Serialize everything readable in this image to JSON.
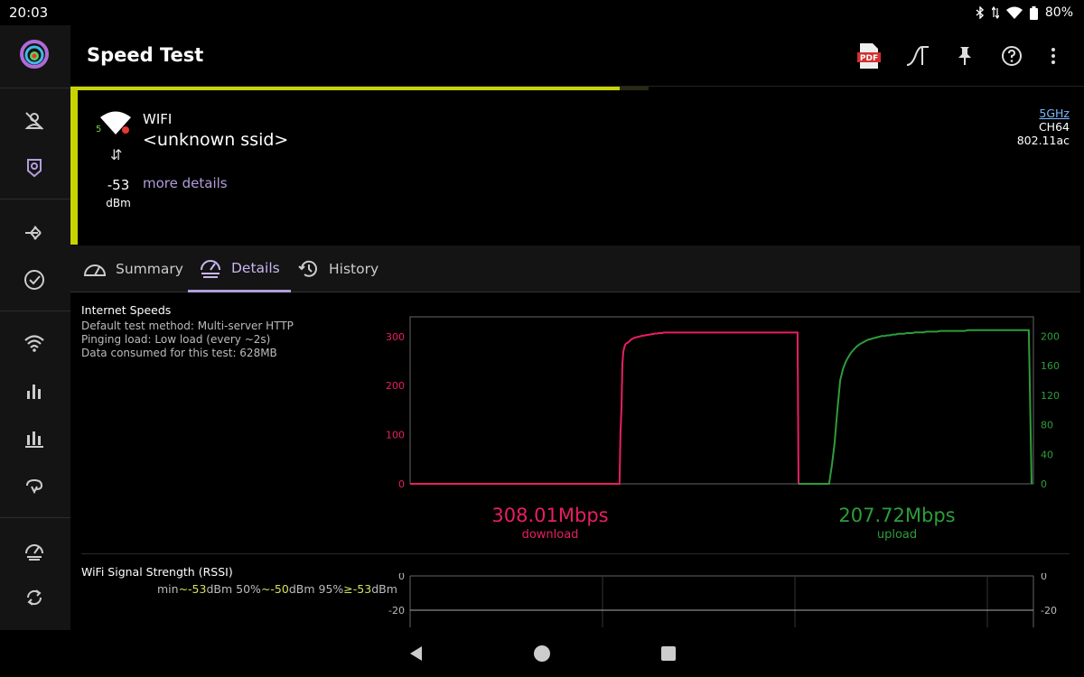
{
  "status": {
    "time": "20:03",
    "battery": "80%"
  },
  "rail": {
    "items": [
      {
        "name": "rail-no-person-icon"
      },
      {
        "name": "rail-badge-icon"
      },
      {
        "name": "rail-route-icon"
      },
      {
        "name": "rail-check-icon"
      },
      {
        "name": "rail-wifi-icon"
      },
      {
        "name": "rail-bar-chart-icon"
      },
      {
        "name": "rail-stacked-chart-icon"
      },
      {
        "name": "rail-loop-icon"
      },
      {
        "name": "rail-speedtest-icon"
      },
      {
        "name": "rail-sync-icon"
      }
    ]
  },
  "appbar": {
    "title": "Speed Test",
    "pdf_label": "PDF"
  },
  "network": {
    "band_small": "5",
    "type": "WIFI",
    "ssid": "<unknown ssid>",
    "rssi": "-53",
    "rssi_unit": "dBm",
    "more_details": "more details",
    "band": "5GHz",
    "channel": "CH64",
    "standard": "802.11ac"
  },
  "tabs": [
    {
      "label": "Summary",
      "active": false
    },
    {
      "label": "Details",
      "active": true
    },
    {
      "label": "History",
      "active": false
    }
  ],
  "internet": {
    "title": "Internet Speeds",
    "lines": [
      "Default test method: Multi-server HTTP",
      "Pinging load: Low load (every ~2s)",
      "Data consumed for this test: 628MB"
    ],
    "download_value": "308.01Mbps",
    "download_label": "download",
    "upload_value": "207.72Mbps",
    "upload_label": "upload"
  },
  "rssi_section": {
    "title": "WiFi Signal Strength (RSSI)",
    "min_label": "min",
    "min_value": "~-53",
    "p50_label": "50%",
    "p50_value": "~-50",
    "p95_label": "95%",
    "p95_value": "≥-53",
    "unit": "dBm"
  },
  "colors": {
    "download": "#e91e63",
    "upload": "#2e9d3a",
    "accent": "#c8d400",
    "tab_active": "#b39ddb"
  },
  "chart_data": [
    {
      "type": "line",
      "title": "",
      "y_left": {
        "ticks": [
          0,
          100,
          200,
          300
        ],
        "range": [
          0,
          340
        ],
        "color": "#e91e63"
      },
      "y_right": {
        "ticks": [
          0,
          40,
          80,
          120,
          160,
          200
        ],
        "range": [
          0,
          226
        ],
        "color": "#2e9d3a"
      },
      "series": [
        {
          "name": "download",
          "axis": "left",
          "color": "#e91e63",
          "values": [
            0,
            0,
            0,
            0,
            0,
            0,
            0,
            0,
            0,
            0,
            0,
            0,
            0,
            0,
            0,
            0,
            0,
            0,
            0,
            0,
            0,
            0,
            0,
            0,
            0,
            0,
            0,
            0,
            0,
            0,
            0,
            0,
            0,
            0,
            0,
            0,
            0,
            0,
            0,
            0,
            0,
            0,
            0,
            0,
            0,
            0,
            0,
            0,
            0,
            0,
            0,
            0,
            0,
            0,
            0,
            0,
            0,
            0,
            0,
            0,
            0,
            0,
            0,
            0,
            0,
            0,
            0,
            0,
            0,
            0,
            0,
            0,
            0,
            0,
            0,
            0,
            0,
            0,
            0,
            0,
            0,
            0,
            0,
            0,
            0,
            0,
            0,
            0,
            0,
            0,
            0,
            0,
            0,
            0,
            0,
            0,
            0,
            0,
            0,
            0,
            0,
            0,
            0,
            0,
            0,
            0,
            0,
            0,
            0,
            0,
            0,
            0,
            0,
            0,
            0,
            0,
            0,
            0,
            0,
            0,
            0,
            0,
            0,
            0,
            0,
            0,
            0,
            0,
            0,
            0,
            0,
            0,
            0,
            0,
            0,
            0,
            0,
            0,
            0,
            0,
            0,
            0,
            0,
            0,
            0,
            0,
            0,
            0,
            0,
            0,
            0,
            0,
            0,
            0,
            0,
            0,
            0,
            0,
            0,
            0,
            0,
            0,
            0,
            0,
            0,
            0,
            0,
            0,
            0,
            0,
            0,
            0,
            0,
            0,
            0,
            0,
            0,
            0,
            0,
            0,
            0,
            0,
            0,
            0,
            0,
            0,
            0,
            0,
            0,
            0,
            0,
            0,
            0,
            0,
            0,
            0,
            0,
            0,
            0,
            0,
            0,
            0,
            0,
            0,
            0,
            0,
            0,
            0,
            0,
            0,
            0,
            0,
            0,
            0,
            0,
            105,
            155,
            245,
            270,
            278,
            284,
            286,
            287,
            288,
            290,
            292,
            294,
            295,
            296,
            297,
            298,
            298,
            299,
            299,
            300,
            300,
            301,
            301,
            302,
            302,
            302,
            303,
            303,
            303,
            304,
            304,
            304,
            305,
            305,
            305,
            306,
            306,
            306,
            306,
            307,
            307,
            307,
            307,
            307,
            308,
            308,
            308,
            308,
            308,
            308,
            308,
            308,
            308,
            308,
            308,
            308,
            308,
            308,
            308,
            308,
            308,
            308,
            308,
            308,
            308,
            308,
            308,
            308,
            308,
            308,
            308,
            308,
            308,
            308,
            308,
            308,
            308,
            308,
            308,
            308,
            308,
            308,
            308,
            308,
            308,
            308,
            308,
            308,
            308,
            308,
            308,
            308,
            308,
            308,
            308,
            308,
            308,
            308,
            308,
            308,
            308,
            308,
            308,
            308,
            308,
            308,
            308,
            308,
            308,
            308,
            308,
            308,
            308,
            308,
            308,
            308,
            308,
            308,
            308,
            308,
            308,
            308,
            308,
            308,
            308,
            308,
            308,
            308,
            308,
            308,
            308,
            308,
            308,
            308,
            308,
            308,
            308,
            308,
            308,
            308,
            308,
            308,
            308,
            308,
            308,
            308,
            308,
            308,
            308,
            308,
            308,
            308,
            308,
            308,
            308,
            308,
            308,
            308,
            308,
            308,
            308,
            308,
            308,
            308,
            308,
            308,
            308,
            308,
            308,
            308,
            308,
            308,
            308,
            308,
            308,
            308,
            308,
            308,
            308,
            308,
            308,
            308,
            0
          ]
        },
        {
          "name": "upload",
          "axis": "right",
          "color": "#2e9d3a",
          "values": [
            0,
            0,
            0,
            0,
            0,
            0,
            0,
            0,
            0,
            0,
            0,
            0,
            25,
            55,
            100,
            140,
            155,
            165,
            172,
            178,
            182,
            186,
            189,
            191,
            193,
            195,
            196,
            197,
            198,
            199,
            200,
            200,
            201,
            201,
            202,
            202,
            203,
            203,
            203,
            204,
            204,
            204,
            205,
            205,
            205,
            205,
            206,
            206,
            206,
            206,
            206,
            207,
            207,
            207,
            207,
            207,
            207,
            207,
            207,
            207,
            207,
            208,
            208,
            208,
            208,
            208,
            208,
            208,
            208,
            208,
            208,
            208,
            208,
            208,
            208,
            208,
            208,
            208,
            208,
            208,
            208,
            208,
            208,
            208,
            0
          ]
        }
      ]
    },
    {
      "type": "line",
      "title": "WiFi Signal Strength (RSSI)",
      "y_left": {
        "ticks": [
          0,
          -20
        ]
      },
      "y_right": {
        "ticks": [
          0,
          -20
        ]
      },
      "series": []
    }
  ]
}
